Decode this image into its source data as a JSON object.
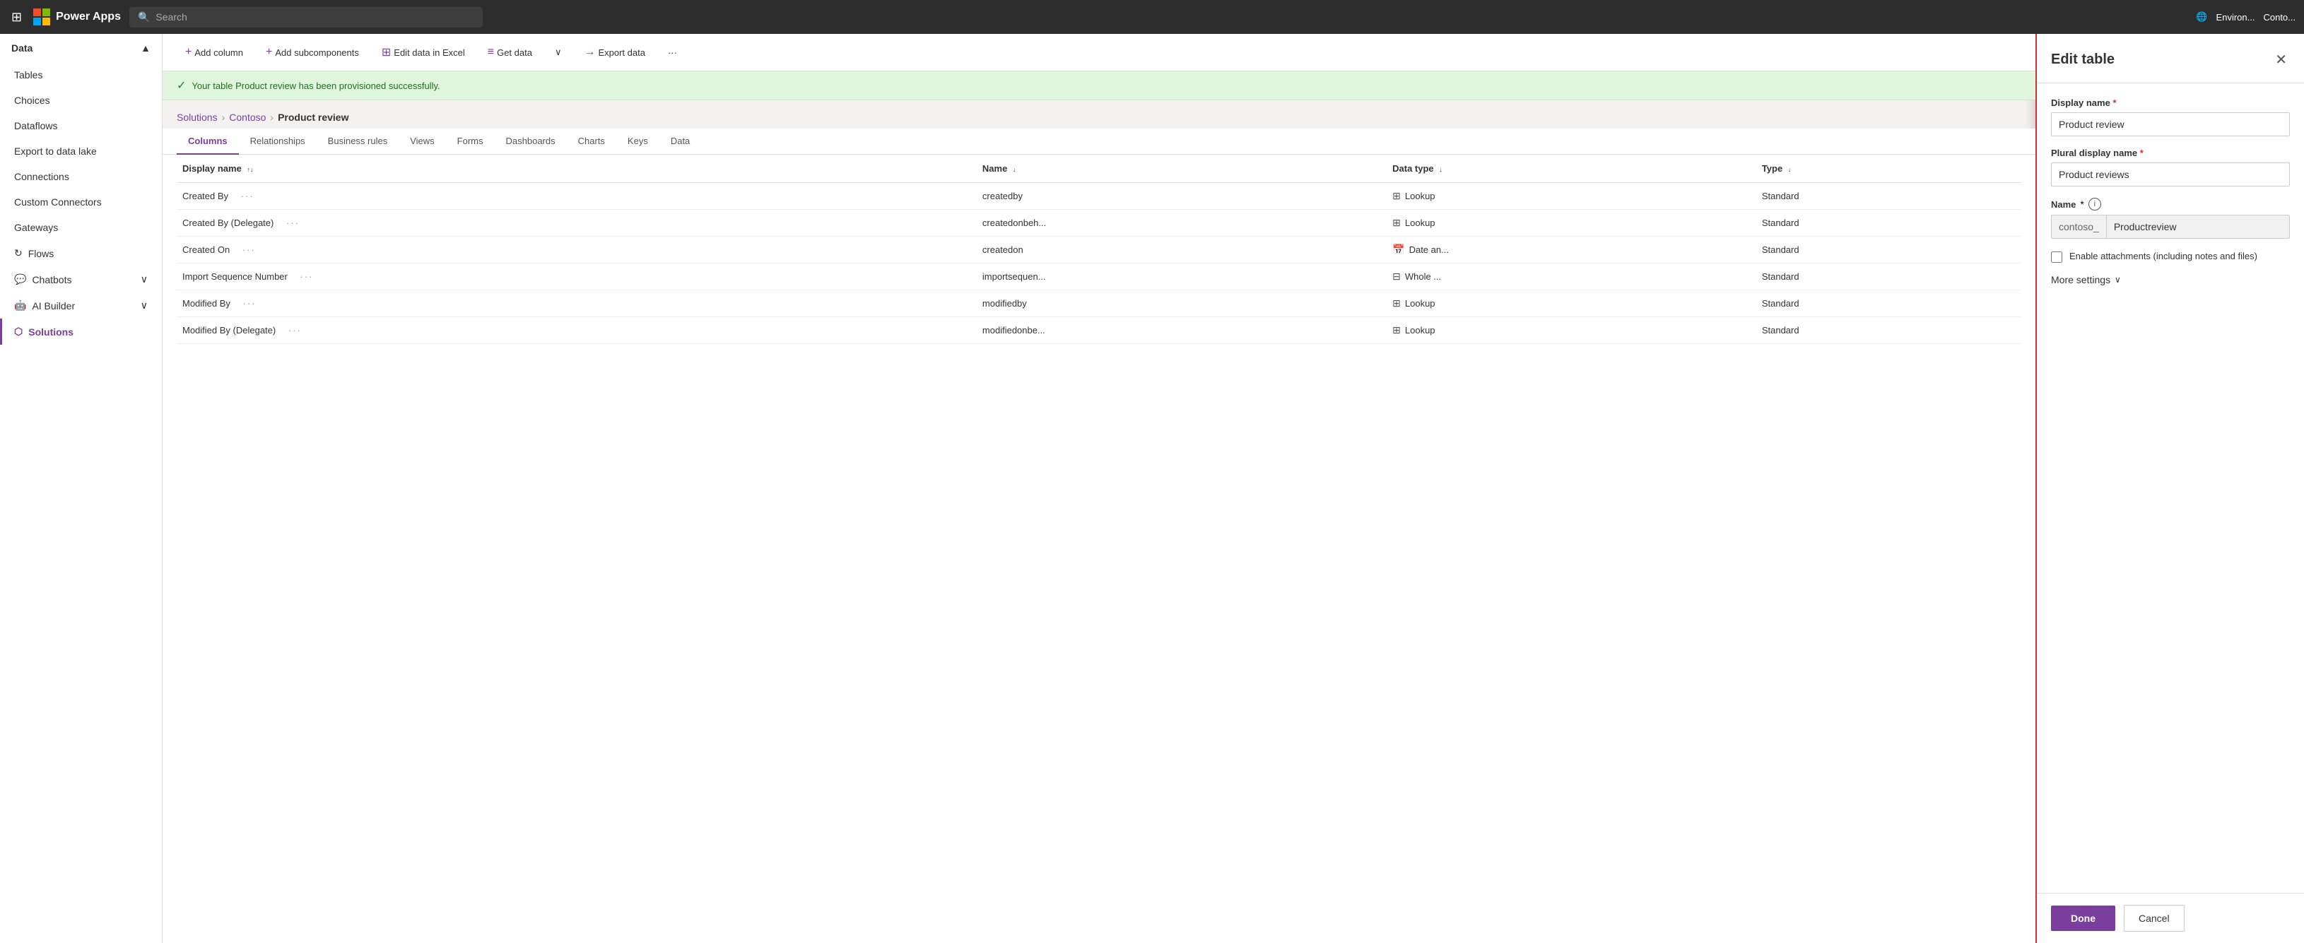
{
  "app": {
    "name": "Power Apps",
    "search_placeholder": "Search"
  },
  "nav_right": {
    "environment_label": "Environ...",
    "account_label": "Conto..."
  },
  "sidebar": {
    "section_header": "Data",
    "items": [
      {
        "id": "tables",
        "label": "Tables",
        "icon": ""
      },
      {
        "id": "choices",
        "label": "Choices",
        "icon": ""
      },
      {
        "id": "dataflows",
        "label": "Dataflows",
        "icon": ""
      },
      {
        "id": "export-to-data-lake",
        "label": "Export to data lake",
        "icon": ""
      },
      {
        "id": "connections",
        "label": "Connections",
        "icon": ""
      },
      {
        "id": "custom-connectors",
        "label": "Custom Connectors",
        "icon": ""
      },
      {
        "id": "gateways",
        "label": "Gateways",
        "icon": ""
      },
      {
        "id": "flows",
        "label": "Flows",
        "icon": "↻"
      },
      {
        "id": "chatbots",
        "label": "Chatbots",
        "icon": "💬"
      },
      {
        "id": "ai-builder",
        "label": "AI Builder",
        "icon": "🤖"
      },
      {
        "id": "solutions",
        "label": "Solutions",
        "icon": "⬡"
      }
    ]
  },
  "toolbar": {
    "add_column_label": "Add column",
    "add_subcomponents_label": "Add subcomponents",
    "edit_data_label": "Edit data in Excel",
    "get_data_label": "Get data",
    "export_data_label": "Export data",
    "more_label": "..."
  },
  "success_banner": {
    "message": "Your table Product review has been provisioned successfully."
  },
  "breadcrumb": {
    "solutions": "Solutions",
    "contoso": "Contoso",
    "current": "Product review"
  },
  "tabs": [
    {
      "id": "columns",
      "label": "Columns",
      "active": true
    },
    {
      "id": "relationships",
      "label": "Relationships"
    },
    {
      "id": "business-rules",
      "label": "Business rules"
    },
    {
      "id": "views",
      "label": "Views"
    },
    {
      "id": "forms",
      "label": "Forms"
    },
    {
      "id": "dashboards",
      "label": "Dashboards"
    },
    {
      "id": "charts",
      "label": "Charts"
    },
    {
      "id": "keys",
      "label": "Keys"
    },
    {
      "id": "data",
      "label": "Data"
    }
  ],
  "table_headers": [
    {
      "id": "display-name",
      "label": "Display name",
      "sortable": true
    },
    {
      "id": "name",
      "label": "Name",
      "sortable": true
    },
    {
      "id": "data-type",
      "label": "Data type",
      "sortable": true
    },
    {
      "id": "type",
      "label": "Type",
      "sortable": true
    }
  ],
  "table_rows": [
    {
      "display_name": "Created By",
      "dots": "···",
      "name": "createdby",
      "data_type": "Lookup",
      "data_type_icon": "⊞",
      "type": "Standard"
    },
    {
      "display_name": "Created By (Delegate)",
      "dots": "···",
      "name": "createdonbeh...",
      "data_type": "Lookup",
      "data_type_icon": "⊞",
      "type": "Standard"
    },
    {
      "display_name": "Created On",
      "dots": "···",
      "name": "createdon",
      "data_type": "Date an...",
      "data_type_icon": "📅",
      "type": "Standard"
    },
    {
      "display_name": "Import Sequence Number",
      "dots": "···",
      "name": "importsequen...",
      "data_type": "Whole ...",
      "data_type_icon": "⊟",
      "type": "Standard"
    },
    {
      "display_name": "Modified By",
      "dots": "···",
      "name": "modifiedby",
      "data_type": "Lookup",
      "data_type_icon": "⊞",
      "type": "Standard"
    },
    {
      "display_name": "Modified By (Delegate)",
      "dots": "···",
      "name": "modifiedonbe...",
      "data_type": "Lookup",
      "data_type_icon": "⊞",
      "type": "Standard"
    }
  ],
  "edit_panel": {
    "title": "Edit table",
    "display_name_label": "Display name",
    "display_name_value": "Product review",
    "plural_display_name_label": "Plural display name",
    "plural_display_name_value": "Product reviews",
    "name_label": "Name",
    "name_prefix": "contoso_",
    "name_value": "Productreview",
    "enable_attachments_label": "Enable attachments (including notes and files)",
    "more_settings_label": "More settings",
    "done_label": "Done",
    "cancel_label": "Cancel"
  }
}
